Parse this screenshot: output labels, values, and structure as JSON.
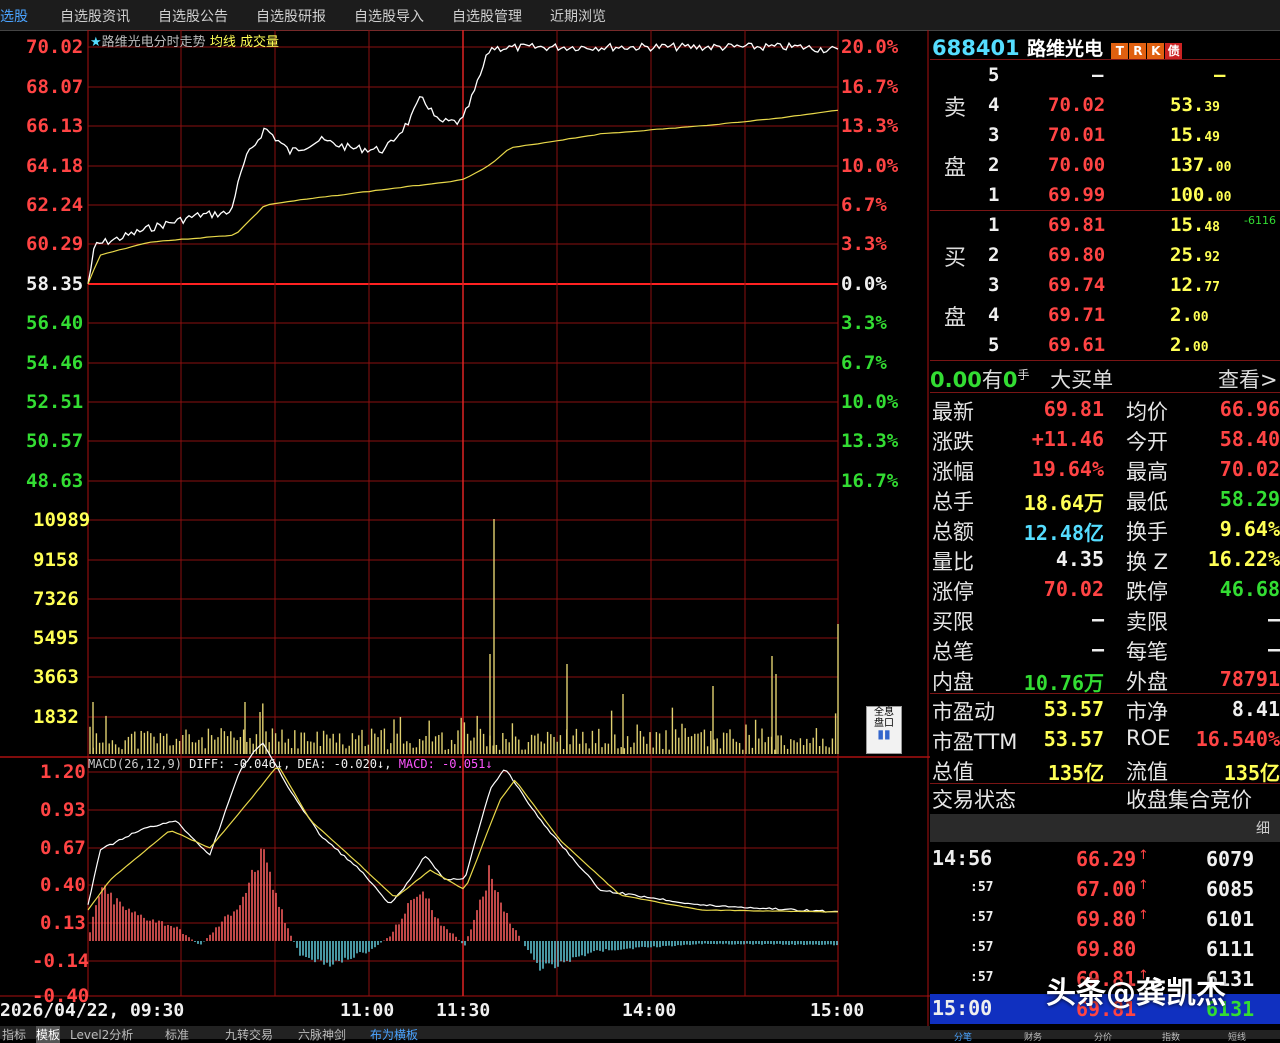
{
  "nav": {
    "items": [
      "选股",
      "自选股资讯",
      "自选股公告",
      "自选股研报",
      "自选股导入",
      "自选股管理",
      "近期浏览"
    ]
  },
  "chart_title": {
    "star": "★",
    "name": "路维光电分时走势",
    "avg": "均线",
    "vol": "成交量"
  },
  "price_axis": {
    "left": [
      "70.02",
      "68.07",
      "66.13",
      "64.18",
      "62.24",
      "60.29",
      "58.35",
      "56.40",
      "54.46",
      "52.51",
      "50.57",
      "48.63"
    ],
    "right": [
      "20.0%",
      "16.7%",
      "13.3%",
      "10.0%",
      "6.7%",
      "3.3%",
      "0.0%",
      "3.3%",
      "6.7%",
      "10.0%",
      "13.3%",
      "16.7%"
    ]
  },
  "volume_axis": [
    "10989",
    "9158",
    "7326",
    "5495",
    "3663",
    "1832"
  ],
  "macd": {
    "title": "MACD(26,12,9)",
    "diff": "DIFF: -0.046↓,",
    "dea": "DEA: -0.020↓,",
    "macd": "MACD: -0.051↓",
    "axis": [
      "1.20",
      "0.93",
      "0.67",
      "0.40",
      "0.13",
      "-0.14",
      "-0.40"
    ]
  },
  "time_axis": [
    "2026/04/22, 09:30",
    "11:00",
    "11:30",
    "14:00",
    "15:00"
  ],
  "full_button": [
    "全息",
    "盘口"
  ],
  "stock": {
    "code": "688401",
    "name": "路维光电",
    "badges": [
      "T",
      "R",
      "K",
      "债"
    ],
    "badge_colors": [
      "#e06010",
      "#e06010",
      "#e06010",
      "#cc2222"
    ]
  },
  "orderbook": {
    "sell_label": [
      "卖",
      "盘"
    ],
    "buy_label": [
      "买",
      "盘"
    ],
    "sell": [
      {
        "lvl": "5",
        "price": "–",
        "vol_int": "–",
        "vol_dec": ""
      },
      {
        "lvl": "4",
        "price": "70.02",
        "vol_int": "53.",
        "vol_dec": "39"
      },
      {
        "lvl": "3",
        "price": "70.01",
        "vol_int": "15.",
        "vol_dec": "49"
      },
      {
        "lvl": "2",
        "price": "70.00",
        "vol_int": "137.",
        "vol_dec": "00"
      },
      {
        "lvl": "1",
        "price": "69.99",
        "vol_int": "100.",
        "vol_dec": "00"
      }
    ],
    "buy": [
      {
        "lvl": "1",
        "price": "69.81",
        "vol_int": "15.",
        "vol_dec": "48"
      },
      {
        "lvl": "2",
        "price": "69.80",
        "vol_int": "25.",
        "vol_dec": "92"
      },
      {
        "lvl": "3",
        "price": "69.74",
        "vol_int": "12.",
        "vol_dec": "77"
      },
      {
        "lvl": "4",
        "price": "69.71",
        "vol_int": "2.",
        "vol_dec": "00"
      },
      {
        "lvl": "5",
        "price": "69.61",
        "vol_int": "2.",
        "vol_dec": "00"
      }
    ],
    "side_note": "-6116"
  },
  "big_order": {
    "value": "0.00",
    "you": "有",
    "count": "0",
    "unit": "手",
    "label": "大买单",
    "link": "查看>"
  },
  "stats": [
    {
      "k": "最新",
      "v": "69.81",
      "c": "red",
      "k2": "均价",
      "v2": "66.96",
      "c2": "red"
    },
    {
      "k": "涨跌",
      "v": "+11.46",
      "c": "red",
      "k2": "今开",
      "v2": "58.40",
      "c2": "red"
    },
    {
      "k": "涨幅",
      "v": "19.64%",
      "c": "red",
      "k2": "最高",
      "v2": "70.02",
      "c2": "red"
    },
    {
      "k": "总手",
      "v": "18.64万",
      "c": "yellow",
      "k2": "最低",
      "v2": "58.29",
      "c2": "green"
    },
    {
      "k": "总额",
      "v": "12.48亿",
      "c": "cyan",
      "k2": "换手",
      "v2": "9.64%",
      "c2": "yellow"
    },
    {
      "k": "量比",
      "v": "4.35",
      "c": "white",
      "k2": "换 Z",
      "v2": "16.22%",
      "c2": "yellow"
    },
    {
      "k": "涨停",
      "v": "70.02",
      "c": "red",
      "k2": "跌停",
      "v2": "46.68",
      "c2": "green"
    },
    {
      "k": "买限",
      "v": "–",
      "c": "white",
      "k2": "卖限",
      "v2": "–",
      "c2": "white"
    },
    {
      "k": "总笔",
      "v": "–",
      "c": "white",
      "k2": "每笔",
      "v2": "–",
      "c2": "white"
    },
    {
      "k": "内盘",
      "v": "10.76万",
      "c": "green",
      "k2": "外盘",
      "v2": "78791",
      "c2": "red"
    },
    {
      "k": "市盈动",
      "v": "53.57",
      "c": "yellow",
      "k2": "市净",
      "v2": "8.41",
      "c2": "white"
    },
    {
      "k": "市盈TTM",
      "v": "53.57",
      "c": "yellow",
      "k2": "ROE",
      "v2": "16.540%",
      "c2": "red"
    },
    {
      "k": "总值",
      "v": "135亿",
      "c": "yellow",
      "k2": "流值",
      "v2": "135亿",
      "c2": "yellow"
    }
  ],
  "trade_status": {
    "k": "交易状态",
    "v": "收盘集合竞价"
  },
  "ticks_header": "细",
  "ticks": [
    {
      "t": "14:56",
      "p": "66.29",
      "arrow": "↑",
      "v": "6079"
    },
    {
      "t": ":57",
      "p": "67.00",
      "arrow": "↑",
      "v": "6085"
    },
    {
      "t": ":57",
      "p": "69.80",
      "arrow": "↑",
      "v": "6101"
    },
    {
      "t": ":57",
      "p": "69.80",
      "arrow": "",
      "v": "6111"
    },
    {
      "t": ":57",
      "p": "69.81",
      "arrow": "↑",
      "v": "6131"
    },
    {
      "t": "15:00",
      "p": "69.81",
      "arrow": "",
      "v": "6131"
    }
  ],
  "bottom_tabs": [
    "指标",
    "模板",
    "Level2分析",
    "标准",
    "九转交易",
    "六脉神剑",
    "布为横板"
  ],
  "right_bottom_tabs": [
    "分笔",
    "财务",
    "分价",
    "指数",
    "短线"
  ],
  "watermark": "头条@龚凯杰"
}
